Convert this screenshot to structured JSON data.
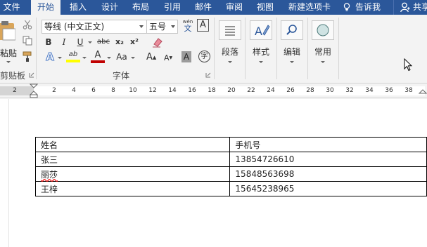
{
  "tabs": [
    {
      "label": "文件",
      "active": false
    },
    {
      "label": "开始",
      "active": true
    },
    {
      "label": "插入",
      "active": false
    },
    {
      "label": "设计",
      "active": false
    },
    {
      "label": "布局",
      "active": false
    },
    {
      "label": "引用",
      "active": false
    },
    {
      "label": "邮件",
      "active": false
    },
    {
      "label": "审阅",
      "active": false
    },
    {
      "label": "视图",
      "active": false
    },
    {
      "label": "新建选项卡",
      "active": false
    }
  ],
  "tell_me": "告诉我",
  "share": "共享",
  "clipboard": {
    "paste_label": "粘贴",
    "group_label": "剪贴板"
  },
  "font": {
    "font_name": "等线 (中文正文)",
    "font_size": "五号",
    "phonetic_label": "wén",
    "phonetic_char": "文",
    "border_char": "A",
    "bold": "B",
    "italic": "I",
    "underline": "U",
    "strikethrough": "abc",
    "subscript": "x₂",
    "superscript": "x²",
    "highlight_glyph": "ab",
    "font_color_glyph": "A",
    "change_case": "Aa",
    "grow": "A",
    "shrink": "A",
    "char_shade": "A",
    "enclose": "字",
    "group_label": "字体",
    "highlight_color": "#ffff00",
    "font_color": "#c00000"
  },
  "paragraph_label": "段落",
  "styles_label": "样式",
  "editing_label": "编辑",
  "common_label": "常用",
  "accent_color": "#2b579a",
  "ruler_ticks": [
    "2",
    "2",
    "4",
    "6",
    "8",
    "10",
    "12",
    "14",
    "16",
    "18",
    "20",
    "22",
    "24",
    "26",
    "28",
    "30",
    "32",
    "34",
    "36",
    "38"
  ],
  "table": {
    "header": [
      "姓名",
      "手机号"
    ],
    "rows": [
      [
        "张三",
        "13854726610"
      ],
      [
        "丽莎",
        "15848563698"
      ],
      [
        "王梓",
        "15645238965"
      ]
    ]
  }
}
